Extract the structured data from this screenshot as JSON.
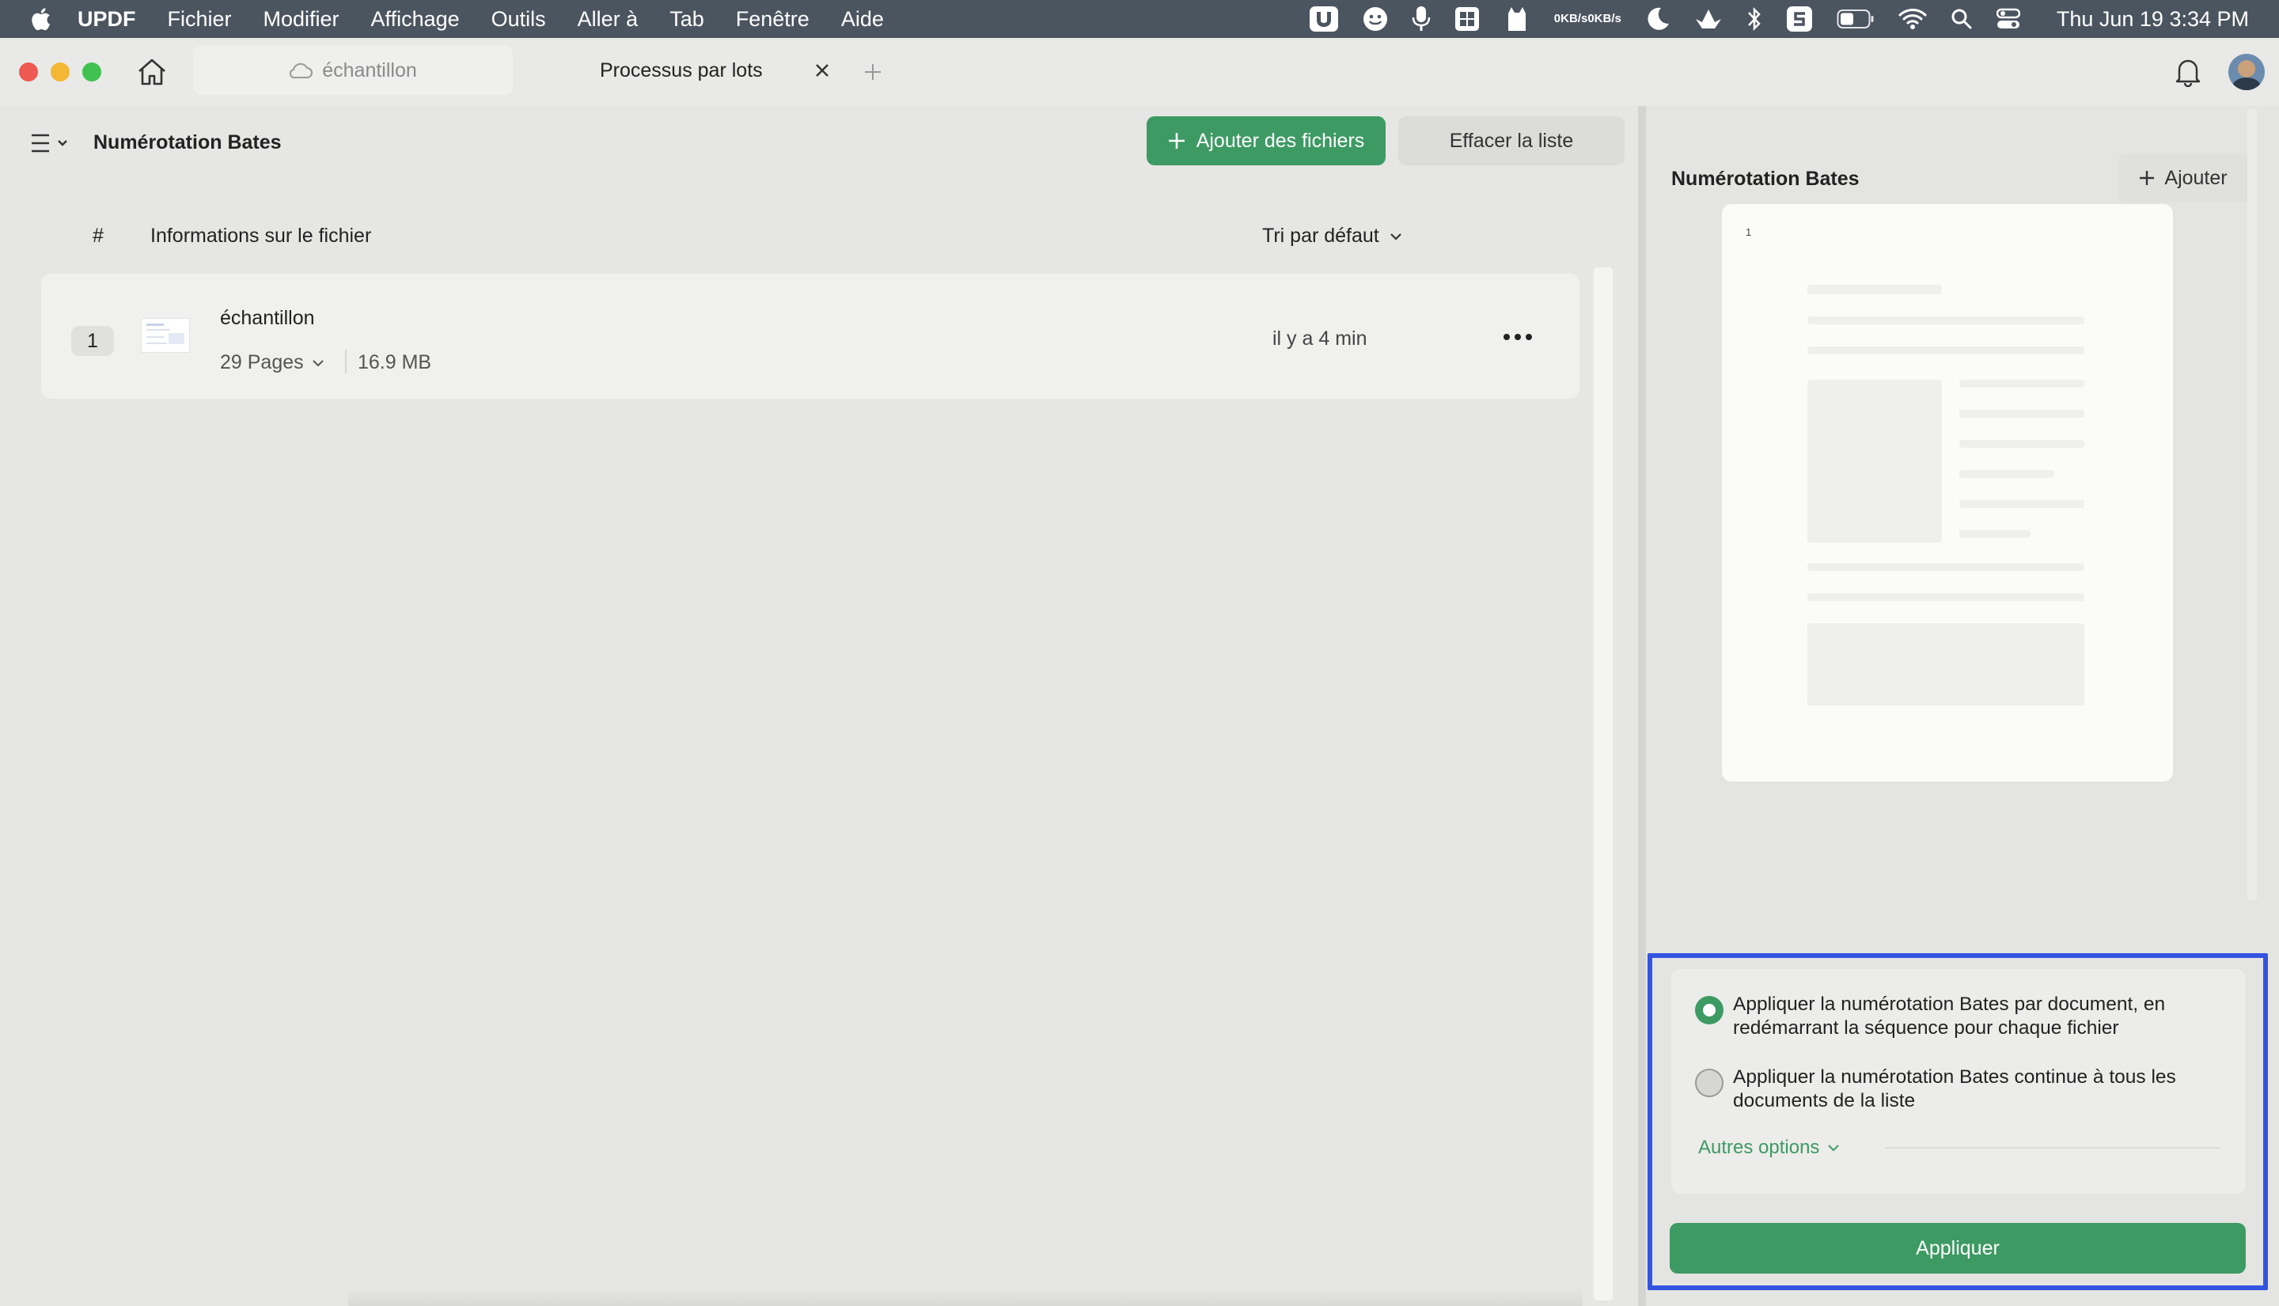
{
  "menubar": {
    "app_name": "UPDF",
    "items": [
      "Fichier",
      "Modifier",
      "Affichage",
      "Outils",
      "Aller à",
      "Tab",
      "Fenêtre",
      "Aide"
    ],
    "net_up": "0KB/s",
    "net_down": "0KB/s",
    "clock": "Thu Jun 19  3:34 PM"
  },
  "tabs": {
    "inactive_label": "échantillon",
    "active_label": "Processus par lots"
  },
  "left": {
    "title": "Numérotation Bates",
    "add_files_label": "Ajouter des fichiers",
    "clear_list_label": "Effacer la liste",
    "col_number": "#",
    "col_info": "Informations sur le fichier",
    "sort_label": "Tri par défaut",
    "files": [
      {
        "index": "1",
        "name": "échantillon",
        "pages": "29 Pages",
        "size": "16.9 MB",
        "time": "il y a 4 min"
      }
    ]
  },
  "right": {
    "title": "Numérotation Bates",
    "add_label": "Ajouter",
    "preview_number": "1",
    "option1": "Appliquer la numérotation Bates par document, en redémarrant la séquence pour chaque fichier",
    "option2": "Appliquer la numérotation Bates continue à tous les documents de la liste",
    "option1_selected": true,
    "more_options_label": "Autres options",
    "apply_label": "Appliquer"
  },
  "colors": {
    "accent_green": "#3d9a63",
    "highlight_blue": "#3354e0"
  }
}
